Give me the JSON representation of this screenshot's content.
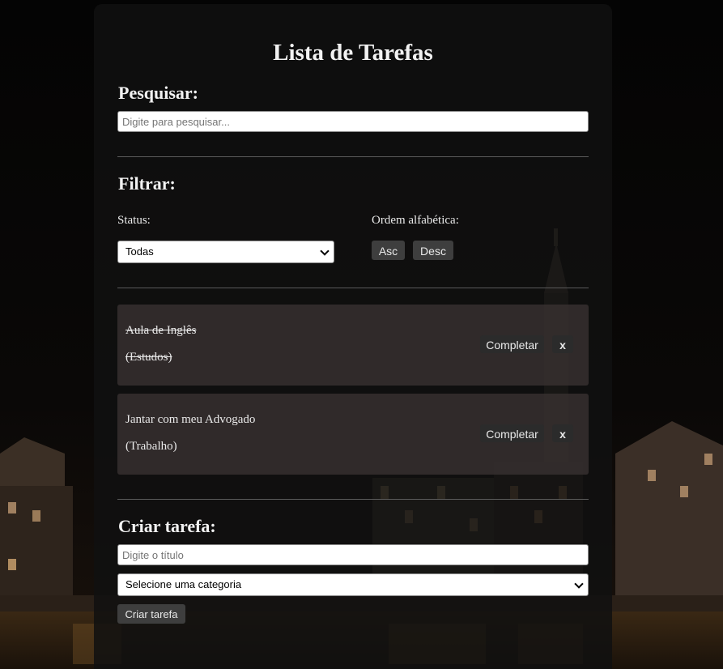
{
  "app": {
    "title": "Lista de Tarefas"
  },
  "search": {
    "heading": "Pesquisar:",
    "placeholder": "Digite para pesquisar...",
    "value": ""
  },
  "filter": {
    "heading": "Filtrar:",
    "status_label": "Status:",
    "status_selected": "Todas",
    "sort_label": "Ordem alfabética:",
    "asc_label": "Asc",
    "desc_label": "Desc"
  },
  "todos": [
    {
      "title": "Aula de Inglês",
      "category": "(Estudos)",
      "completed": true,
      "complete_label": "Completar",
      "remove_label": "x"
    },
    {
      "title": "Jantar com meu Advogado",
      "category": "(Trabalho)",
      "completed": false,
      "complete_label": "Completar",
      "remove_label": "x"
    }
  ],
  "create": {
    "heading": "Criar tarefa:",
    "title_placeholder": "Digite o título",
    "category_selected": "Selecione uma categoria",
    "submit_label": "Criar tarefa"
  },
  "colors": {
    "panel_bg": "#101010",
    "todo_bg": "#3a3232",
    "button_bg": "#3e3e3e",
    "text": "#f2f2f2"
  }
}
